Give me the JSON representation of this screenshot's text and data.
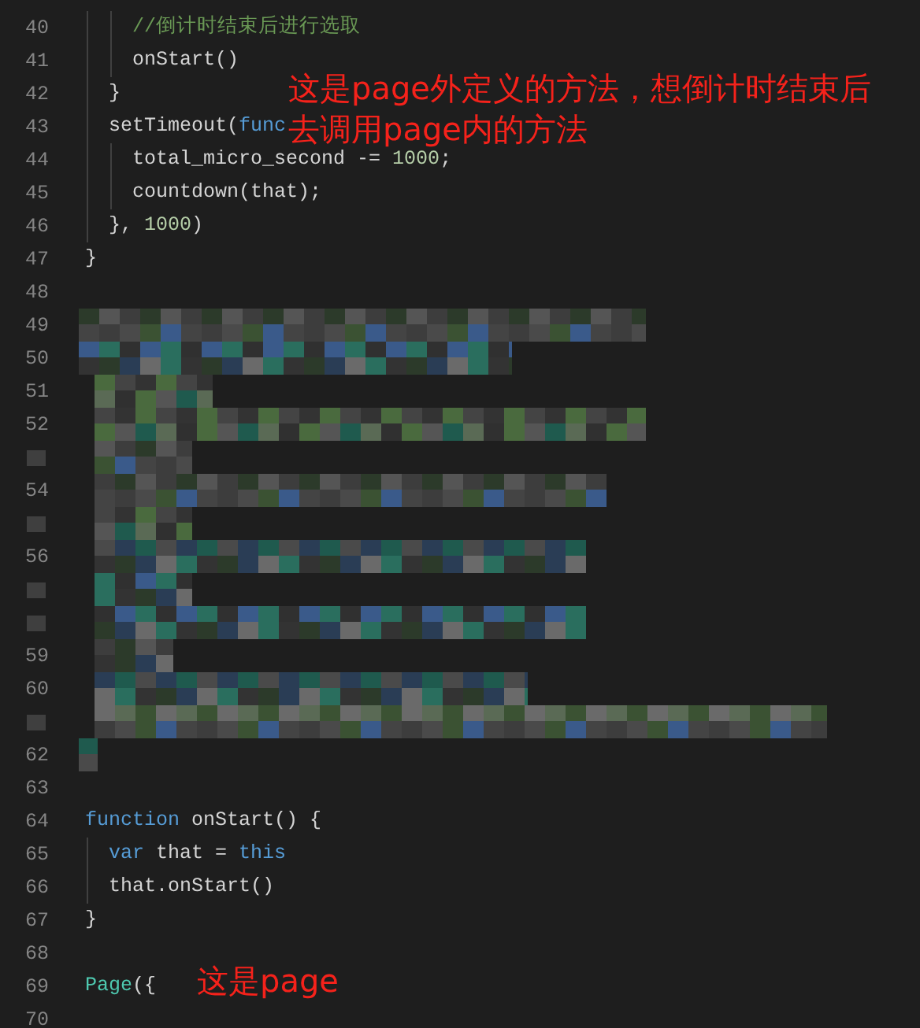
{
  "editor": {
    "lines": [
      {
        "number": "40",
        "kind": "code",
        "tokens": [
          {
            "text": "    //倒计时结束后进行选取",
            "kind": "comment"
          }
        ]
      },
      {
        "number": "41",
        "kind": "code",
        "tokens": [
          {
            "text": "    onStart()",
            "kind": "plain"
          }
        ]
      },
      {
        "number": "42",
        "kind": "code",
        "tokens": [
          {
            "text": "  }",
            "kind": "plain"
          }
        ],
        "note": {
          "lines": [
            "这是page外定义的方法，想倒计时结束后",
            "去调用page内的方法"
          ]
        }
      },
      {
        "number": "43",
        "kind": "code",
        "tokens": [
          {
            "text": "  setTimeout(",
            "kind": "plain"
          },
          {
            "text": "func",
            "kind": "keyword"
          }
        ]
      },
      {
        "number": "44",
        "kind": "code",
        "tokens": [
          {
            "text": "    total_micro_second -= ",
            "kind": "plain"
          },
          {
            "text": "1000",
            "kind": "number"
          },
          {
            "text": ";",
            "kind": "plain"
          }
        ]
      },
      {
        "number": "45",
        "kind": "code",
        "tokens": [
          {
            "text": "    countdown(that);",
            "kind": "plain"
          }
        ]
      },
      {
        "number": "46",
        "kind": "code",
        "tokens": [
          {
            "text": "  }, ",
            "kind": "plain"
          },
          {
            "text": "1000",
            "kind": "number"
          },
          {
            "text": ")",
            "kind": "plain"
          }
        ]
      },
      {
        "number": "47",
        "kind": "code",
        "tokens": [
          {
            "text": "}",
            "kind": "plain"
          }
        ]
      },
      {
        "number": "48",
        "kind": "code"
      },
      {
        "number": "49",
        "kind": "pixelated"
      },
      {
        "number": "50",
        "kind": "pixelated"
      },
      {
        "number": "51",
        "kind": "pixelated"
      },
      {
        "number": "52",
        "kind": "pixelated"
      },
      {
        "kind": "pixelated"
      },
      {
        "number": "54",
        "kind": "pixelated"
      },
      {
        "kind": "pixelated"
      },
      {
        "number": "56",
        "kind": "pixelated"
      },
      {
        "kind": "pixelated"
      },
      {
        "kind": "pixelated"
      },
      {
        "number": "59",
        "kind": "pixelated"
      },
      {
        "number": "60",
        "kind": "pixelated"
      },
      {
        "kind": "pixelated"
      },
      {
        "number": "62",
        "kind": "pixelated"
      },
      {
        "number": "63",
        "kind": "code"
      },
      {
        "number": "64",
        "kind": "code",
        "tokens": [
          {
            "text": "function",
            "kind": "keyword"
          },
          {
            "text": " onStart() {",
            "kind": "plain"
          }
        ]
      },
      {
        "number": "65",
        "kind": "code",
        "tokens": [
          {
            "text": "  var",
            "kind": "keyword"
          },
          {
            "text": " that = ",
            "kind": "plain"
          },
          {
            "text": "this",
            "kind": "keyword"
          }
        ]
      },
      {
        "number": "66",
        "kind": "code",
        "tokens": [
          {
            "text": "  that.onStart()",
            "kind": "plain"
          }
        ]
      },
      {
        "number": "67",
        "kind": "code",
        "tokens": [
          {
            "text": "}",
            "kind": "plain"
          }
        ]
      },
      {
        "number": "68",
        "kind": "code"
      },
      {
        "number": "69",
        "kind": "code",
        "tokens": [
          {
            "text": "Page",
            "kind": "class"
          },
          {
            "text": "({",
            "kind": "plain"
          }
        ],
        "note": {
          "lines": [
            "这是page"
          ]
        }
      },
      {
        "number": "70",
        "kind": "code"
      }
    ]
  }
}
